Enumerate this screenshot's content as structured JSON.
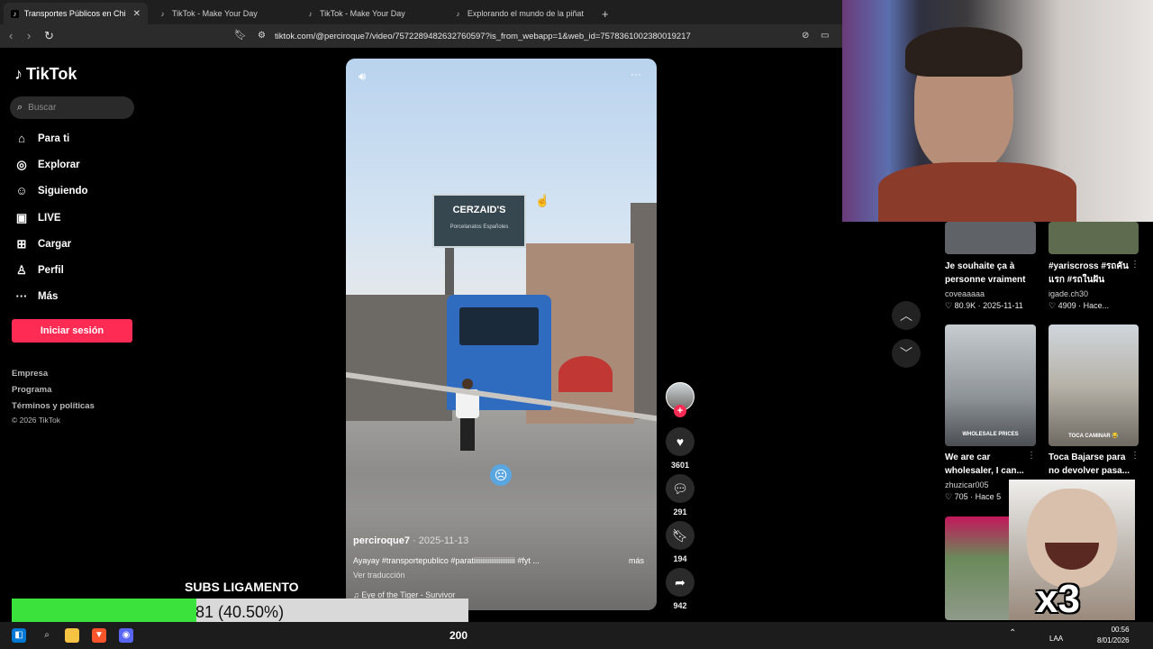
{
  "browser": {
    "tabs": [
      {
        "label": "Transportes Públicos en Chile",
        "active": true
      },
      {
        "label": "TikTok - Make Your Day",
        "active": false
      },
      {
        "label": "TikTok - Make Your Day",
        "active": false
      },
      {
        "label": "Explorando el mundo de la piñata en",
        "active": false
      }
    ],
    "new_tab": "+",
    "url": "tiktok.com/@perciroque7/video/7572289482632760597?is_from_webapp=1&web_id=7578361002380019217"
  },
  "sidebar": {
    "logo": "TikTok",
    "search_placeholder": "Buscar",
    "nav": [
      {
        "label": "Para ti",
        "icon": "home-icon"
      },
      {
        "label": "Explorar",
        "icon": "compass-icon"
      },
      {
        "label": "Siguiendo",
        "icon": "following-icon"
      },
      {
        "label": "LIVE",
        "icon": "live-icon"
      },
      {
        "label": "Cargar",
        "icon": "upload-icon"
      },
      {
        "label": "Perfil",
        "icon": "profile-icon"
      },
      {
        "label": "Más",
        "icon": "more-icon"
      }
    ],
    "login": "Iniciar sesión",
    "footer": [
      "Empresa",
      "Programa",
      "Términos y políticas",
      "© 2026 TikTok"
    ]
  },
  "video": {
    "author": "perciroque7",
    "date": " · 2025-11-13",
    "caption": "Ayayay #transportepublico #paratiiiiiiiiiiiiiiiiiiiiiii #fyt ...",
    "more": "más",
    "translate": "Ver traducción",
    "music": "♫  Eye of the Tiger - Survivor",
    "billboard": "CERZAID'S",
    "billboard_sub": "Porcelanatos Españoles",
    "stat_likes": "3601",
    "stat_comments": "291",
    "stat_saves": "194",
    "stat_shares": "942"
  },
  "grid": {
    "cards": [
      {
        "title_1": "Je souhaite ça à",
        "title_2": "personne vraiment",
        "user": "coveaaaaa",
        "likes": "♡ 80.9K",
        "date": "· 2025-11-11"
      },
      {
        "title_1": "#yariscross #รถคัน",
        "title_2": "แรก #รถในฝัน",
        "user": "igade.ch30",
        "likes": "♡ 4909",
        "date": "· Hace..."
      },
      {
        "title_1": "We are car",
        "title_2": "wholesaler, I can...",
        "user": "zhuzicar005",
        "likes": "♡ 705",
        "date": "· Hace 5",
        "overlay": "WHOLESALE PRICES"
      },
      {
        "title_1": "Toca Bajarse para",
        "title_2": "no devolver pasa...",
        "user": "",
        "likes": "",
        "date": "",
        "overlay": "TOCA CAMINAR 😂"
      }
    ]
  },
  "stream": {
    "subs_label": "SUBS LIGAMENTO",
    "subs_text": "81 (40.50%)",
    "subs_progress": 0.405,
    "multiplier": "x3"
  },
  "taskbar": {
    "number": "200",
    "lang": "LAA",
    "time": "00:56",
    "date": "8/01/2026"
  }
}
